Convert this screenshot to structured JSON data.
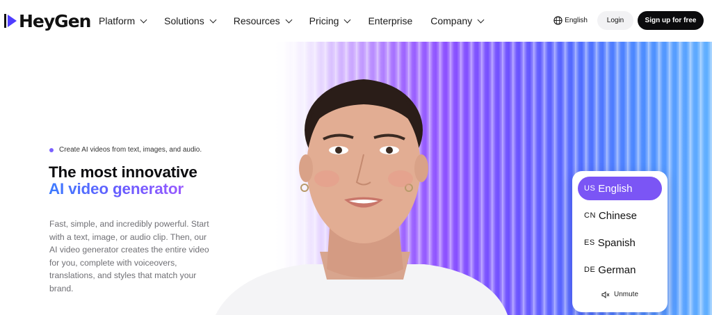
{
  "brand": {
    "logo_text": "HeyGen"
  },
  "nav": {
    "items": [
      {
        "label": "Platform",
        "has_dropdown": true
      },
      {
        "label": "Solutions",
        "has_dropdown": true
      },
      {
        "label": "Resources",
        "has_dropdown": true
      },
      {
        "label": "Pricing",
        "has_dropdown": true
      },
      {
        "label": "Enterprise",
        "has_dropdown": false
      },
      {
        "label": "Company",
        "has_dropdown": true
      }
    ],
    "language_label": "English",
    "login_label": "Login",
    "signup_label": "Sign up for free"
  },
  "hero": {
    "eyebrow": "Create AI videos from text, images, and audio.",
    "title_line1": "The most innovative",
    "title_line2": "AI video generator",
    "description": "Fast, simple, and incredibly powerful. Start with a text, image, or audio clip. Then, our AI video generator creates the entire video for you, complete with voiceovers, translations, and styles that match your brand."
  },
  "language_card": {
    "options": [
      {
        "code": "US",
        "label": "English",
        "selected": true
      },
      {
        "code": "CN",
        "label": "Chinese",
        "selected": false
      },
      {
        "code": "ES",
        "label": "Spanish",
        "selected": false
      },
      {
        "code": "DE",
        "label": "German",
        "selected": false
      }
    ],
    "unmute_label": "Unmute"
  },
  "colors": {
    "accent": "#7b55f5",
    "signup_bg": "#0b0b0d",
    "eyebrow_dot": "#7b61ff"
  },
  "icons": [
    "play-logo-icon",
    "chevron-down-icon",
    "globe-icon",
    "mute-speaker-icon"
  ]
}
